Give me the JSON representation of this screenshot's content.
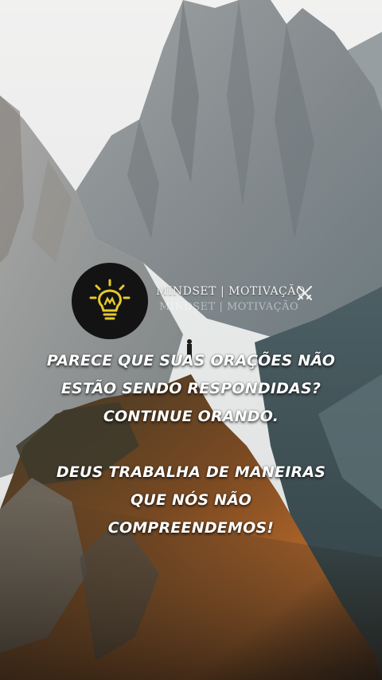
{
  "brand": {
    "name": "MINDSET | MOTIVAÇÃO",
    "name_reflection": "MINDSET | MOTIVAÇÃO",
    "logo_icon": "lightbulb-icon",
    "badge_icon": "crossed-swords-icon",
    "accent_color": "#e6c92e"
  },
  "quote": {
    "paragraph1": [
      "PARECE QUE SUAS ORAÇÕES NÃO",
      "ESTÃO SENDO RESPONDIDAS?",
      "CONTINUE ORANDO."
    ],
    "paragraph2": [
      "DEUS TRABALHA DE MANEIRAS",
      "QUE NÓS NÃO",
      "COMPREENDEMOS!"
    ]
  }
}
